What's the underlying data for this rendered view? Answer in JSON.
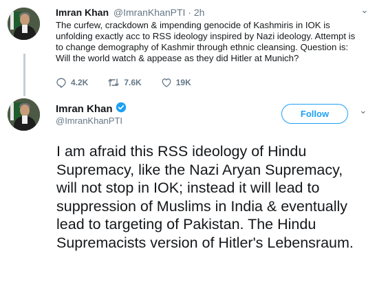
{
  "tweet1": {
    "author_name": "Imran Khan",
    "author_handle": "@ImranKhanPTI",
    "separator": "·",
    "time": "2h",
    "text": "The curfew, crackdown & impending genocide of Kashmiris in IOK is unfolding exactly acc to RSS ideology inspired by Nazi ideology. Attempt is to change demography of Kashmir through ethnic cleansing. Question is: Will the world watch & appease as they did Hitler at Munich?",
    "caret": "⌄",
    "actions": {
      "reply_count": "4.2K",
      "retweet_count": "7.6K",
      "like_count": "19K"
    }
  },
  "tweet2": {
    "author_name": "Imran Khan",
    "author_handle": "@ImranKhanPTI",
    "follow_label": "Follow",
    "caret": "⌄",
    "text": "I am afraid this RSS ideology of Hindu Supremacy, like the Nazi Aryan Supremacy, will not stop in IOK; instead it will lead to suppression of Muslims in India & eventually lead to targeting of Pakistan. The Hindu Supremacists version of Hitler's Lebensraum."
  },
  "icons": {
    "reply": "reply-icon",
    "retweet": "retweet-icon",
    "like": "heart-icon",
    "verified": "verified-badge-icon",
    "caret": "chevron-down-icon"
  },
  "colors": {
    "accent": "#1da1f2",
    "secondary_text": "#657786",
    "thread_line": "#c4cfd6"
  }
}
